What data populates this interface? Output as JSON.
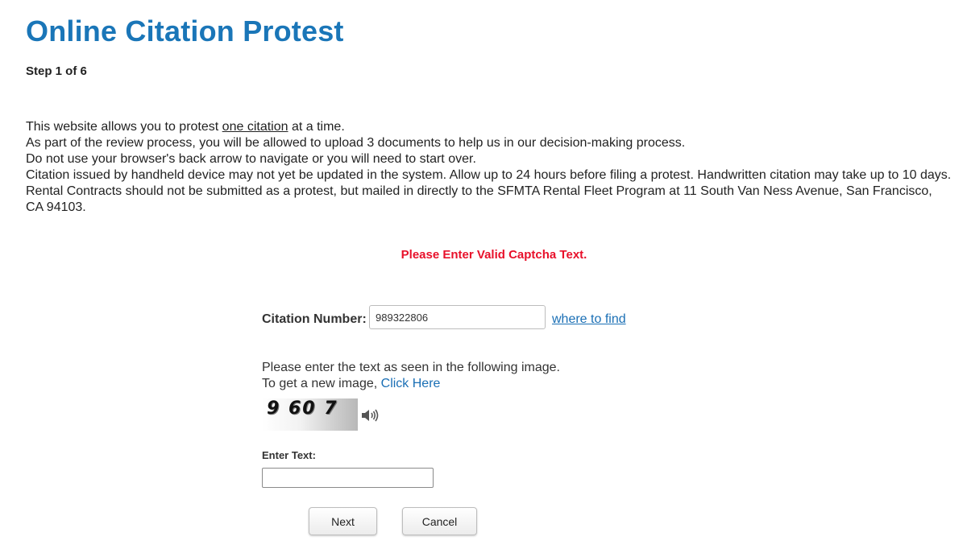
{
  "header": {
    "title": "Online Citation Protest",
    "step": "Step 1 of 6"
  },
  "intro": {
    "line1_before": "This website allows you to protest ",
    "line1_link": "one citation",
    "line1_after": " at a time.",
    "line2": "As part of the review process, you will be allowed to upload 3 documents to help us in our decision-making process.",
    "line3": "Do not use your browser's back arrow to navigate or you will need to start over.",
    "line4": "Citation issued by handheld device may not yet be updated in the system. Allow up to 24 hours before filing a protest. Handwritten citation may take up to 10 days.",
    "line5": "Rental Contracts should not be submitted as a protest, but mailed in directly to the SFMTA Rental Fleet Program at 11 South Van Ness Avenue, San Francisco, CA 94103."
  },
  "error": {
    "message": "Please Enter Valid Captcha Text."
  },
  "form": {
    "citation_label": "Citation Number:",
    "citation_value": "989322806",
    "where_link": "where to find",
    "instruction_line1": "Please enter the text as seen in the following image.",
    "instruction_line2_before": "To get a new image, ",
    "click_here": "Click Here",
    "captcha_text": "9 60 7",
    "enter_text_label": "Enter Text:",
    "enter_text_value": ""
  },
  "buttons": {
    "next": "Next",
    "cancel": "Cancel"
  },
  "icons": {
    "speaker": "speaker-icon"
  },
  "colors": {
    "title": "#1a76b8",
    "link": "#1a6fb5",
    "error": "#e8102a"
  }
}
